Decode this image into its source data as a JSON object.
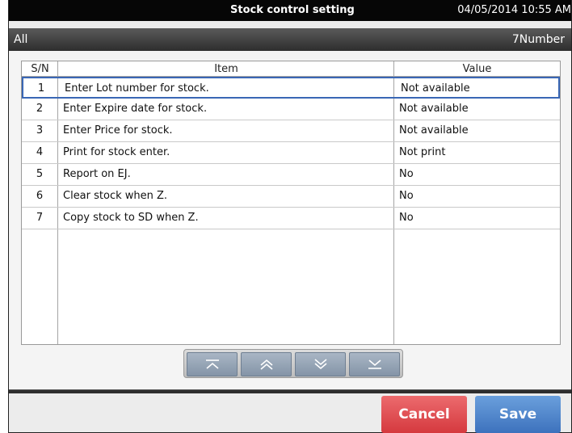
{
  "titlebar": {
    "title": "Stock control setting",
    "datetime": "04/05/2014 10:55 AM"
  },
  "header": {
    "filter": "All",
    "count": "7Number"
  },
  "table": {
    "columns": [
      "S/N",
      "Item",
      "Value"
    ],
    "rows": [
      {
        "sn": "1",
        "item": "Enter Lot number for stock.",
        "value": "Not available"
      },
      {
        "sn": "2",
        "item": "Enter Expire date for stock.",
        "value": "Not available"
      },
      {
        "sn": "3",
        "item": "Enter Price for stock.",
        "value": "Not available"
      },
      {
        "sn": "4",
        "item": "Print for stock enter.",
        "value": "Not print"
      },
      {
        "sn": "5",
        "item": "Report on EJ.",
        "value": "No"
      },
      {
        "sn": "6",
        "item": "Clear stock when Z.",
        "value": "No"
      },
      {
        "sn": "7",
        "item": "Copy stock to SD when Z.",
        "value": "No"
      }
    ]
  },
  "nav": [
    "page-top-icon",
    "page-up-icon",
    "page-down-icon",
    "page-bottom-icon"
  ],
  "buttons": {
    "cancel": "Cancel",
    "save": "Save"
  },
  "colors": {
    "cancel": "#d5393e",
    "save": "#3d72bd",
    "selection": "#3a67b5",
    "titlebar": "#060606"
  }
}
